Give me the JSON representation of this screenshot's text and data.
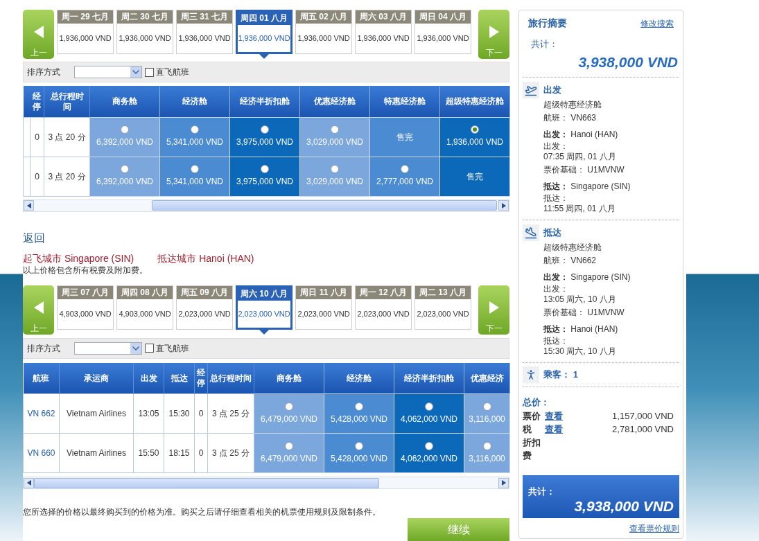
{
  "outbound": {
    "prev_button": "上一",
    "next_button": "下一",
    "dates": [
      {
        "day": "周一 29 七月",
        "price": "1,936,000 VND",
        "selected": false
      },
      {
        "day": "周二 30 七月",
        "price": "1,936,000 VND",
        "selected": false
      },
      {
        "day": "周三 31 七月",
        "price": "1,936,000 VND",
        "selected": false
      },
      {
        "day": "周四 01 八月",
        "price": "1,936,000 VND",
        "selected": true
      },
      {
        "day": "周五 02 八月",
        "price": "1,936,000 VND",
        "selected": false
      },
      {
        "day": "周六 03 八月",
        "price": "1,936,000 VND",
        "selected": false
      },
      {
        "day": "周日 04 八月",
        "price": "1,936,000 VND",
        "selected": false
      }
    ],
    "sort_label": "排序方式",
    "nonstop": {
      "label": "直飞航班",
      "checked": false
    },
    "table": {
      "info_columns": [
        "经停",
        "总行程时间"
      ],
      "fare_columns": [
        "商务舱",
        "经济舱",
        "经济半折扣舱",
        "优惠经济舱",
        "特惠经济舱",
        "超级特惠经济舱"
      ],
      "rows": [
        {
          "cells": [
            "0",
            "3 点 20 分"
          ],
          "fares": [
            {
              "kind": "fare",
              "price": "6,392,000 VND",
              "selected": false
            },
            {
              "kind": "fare",
              "price": "5,341,000 VND",
              "selected": false
            },
            {
              "kind": "fare",
              "price": "3,975,000 VND",
              "selected": false
            },
            {
              "kind": "fare",
              "price": "3,029,000 VND",
              "selected": false
            },
            {
              "kind": "sold_out",
              "label": "售完"
            },
            {
              "kind": "fare",
              "price": "1,936,000 VND",
              "selected": true
            }
          ]
        },
        {
          "cells": [
            "0",
            "3 点 20 分"
          ],
          "fares": [
            {
              "kind": "fare",
              "price": "6,392,000 VND",
              "selected": false
            },
            {
              "kind": "fare",
              "price": "5,341,000 VND",
              "selected": false
            },
            {
              "kind": "fare",
              "price": "3,975,000 VND",
              "selected": false
            },
            {
              "kind": "fare",
              "price": "3,029,000 VND",
              "selected": false
            },
            {
              "kind": "fare",
              "price": "2,777,000 VND",
              "selected": false
            },
            {
              "kind": "sold_out",
              "label": "售完"
            }
          ]
        }
      ]
    }
  },
  "return_title": "返回",
  "origin": "起飞城市 Singapore (SIN)",
  "destination": "抵达城市 Hanoi (HAN)",
  "tax_note": "以上价格包含所有税费及附加费。",
  "inbound": {
    "prev_button": "上一",
    "next_button": "下一",
    "dates": [
      {
        "day": "周三 07 八月",
        "price": "4,903,000 VND",
        "selected": false
      },
      {
        "day": "周四 08 八月",
        "price": "4,903,000 VND",
        "selected": false
      },
      {
        "day": "周五 09 八月",
        "price": "2,023,000 VND",
        "selected": false
      },
      {
        "day": "周六 10 八月",
        "price": "2,023,000 VND",
        "selected": true
      },
      {
        "day": "周日 11 八月",
        "price": "2,023,000 VND",
        "selected": false
      },
      {
        "day": "周一 12 八月",
        "price": "2,023,000 VND",
        "selected": false
      },
      {
        "day": "周二 13 八月",
        "price": "2,023,000 VND",
        "selected": false
      }
    ],
    "sort_label": "排序方式",
    "nonstop": {
      "label": "直飞航班",
      "checked": false
    },
    "table": {
      "info_columns": [
        "航班",
        "承运商",
        "出发",
        "抵达",
        "经停",
        "总行程时间"
      ],
      "fare_columns": [
        "商务舱",
        "经济舱",
        "经济半折扣舱",
        "优惠经济"
      ],
      "rows": [
        {
          "flight": "VN 662",
          "cells": [
            "Vietnam Airlines",
            "13:05",
            "15:30",
            "0",
            "3 点 25 分"
          ],
          "fares": [
            {
              "kind": "fare",
              "price": "6,479,000 VND",
              "selected": false
            },
            {
              "kind": "fare",
              "price": "5,428,000 VND",
              "selected": false
            },
            {
              "kind": "fare",
              "price": "4,062,000 VND",
              "selected": false
            },
            {
              "kind": "fare",
              "price": "3,116,000",
              "selected": false
            }
          ]
        },
        {
          "flight": "VN 660",
          "cells": [
            "Vietnam Airlines",
            "15:50",
            "18:15",
            "0",
            "3 点 25 分"
          ],
          "fares": [
            {
              "kind": "fare",
              "price": "6,479,000 VND",
              "selected": false
            },
            {
              "kind": "fare",
              "price": "5,428,000 VND",
              "selected": false
            },
            {
              "kind": "fare",
              "price": "4,062,000 VND",
              "selected": false
            },
            {
              "kind": "fare",
              "price": "3,116,000",
              "selected": false
            }
          ]
        }
      ]
    }
  },
  "footnote": "您所选择的价格以最终购买到的价格为准。购买之后请仔细查看相关的机票使用规则及限制条件。",
  "continue_button": "继续",
  "summary": {
    "title": "旅行摘要",
    "edit_link": "修改搜索",
    "total_label": "共计：",
    "total": "3,938,000 VND",
    "segments": [
      {
        "kind": "departure",
        "heading": "出发",
        "cabin": "超级特惠经济舱",
        "flight_label": "航班：",
        "flight": "VN663",
        "from_label": "出发：",
        "from": "Hanoi (HAN)",
        "dep_label": "出发：",
        "dep_time": "07:35 周四, 01 八月",
        "basis_label": "票价基础：",
        "basis": "U1MVNW",
        "to_label": "抵达：",
        "to": "Singapore (SIN)",
        "arr_label": "抵达：",
        "arr_time": "11:55 周四, 01 八月"
      },
      {
        "kind": "arrival",
        "heading": "抵达",
        "cabin": "超级特惠经济舱",
        "flight_label": "航班：",
        "flight": "VN662",
        "from_label": "出发：",
        "from": "Singapore (SIN)",
        "dep_label": "出发：",
        "dep_time": "13:05 周六, 10 八月",
        "basis_label": "票价基础：",
        "basis": "U1MVNW",
        "to_label": "抵达：",
        "to": "Hanoi (HAN)",
        "arr_label": "抵达：",
        "arr_time": "15:30 周六, 10 八月"
      }
    ],
    "passengers_label": "乘客：",
    "passengers": "1",
    "price_title": "总价：",
    "price_lines": [
      {
        "label": "票价",
        "link": "查看",
        "amount": "1,157,000 VND"
      },
      {
        "label": "税",
        "link": "查看",
        "amount": "2,781,000 VND"
      },
      {
        "label": "折扣费"
      }
    ],
    "grand_total_label": "共计：",
    "grand_total": "3,938,000 VND",
    "rules_link": "查看票价规则"
  }
}
